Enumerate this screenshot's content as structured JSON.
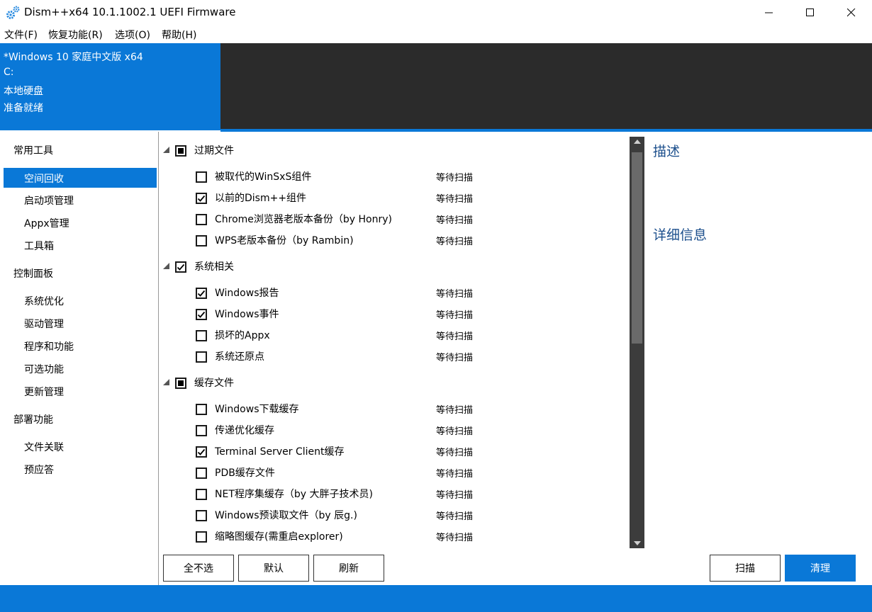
{
  "window": {
    "title": "Dism++x64 10.1.1002.1 UEFI Firmware",
    "minimize_icon": "minimize-icon",
    "maximize_icon": "maximize-icon",
    "close_icon": "close-icon"
  },
  "menu": [
    "文件(F)",
    "恢复功能(R)",
    "选项(O)",
    "帮助(H)"
  ],
  "system": {
    "os": "*Windows 10 家庭中文版 x64",
    "drive": "C:",
    "disk_type": "本地硬盘",
    "status": "准备就绪"
  },
  "sidebar": {
    "groups": [
      {
        "label": "常用工具",
        "items": [
          "空间回收",
          "启动项管理",
          "Appx管理",
          "工具箱"
        ]
      },
      {
        "label": "控制面板",
        "items": [
          "系统优化",
          "驱动管理",
          "程序和功能",
          "可选功能",
          "更新管理"
        ]
      },
      {
        "label": "部署功能",
        "items": [
          "文件关联",
          "预应答"
        ]
      }
    ],
    "selected": "空间回收"
  },
  "cleanup": {
    "status_text": "等待扫描",
    "groups": [
      {
        "label": "过期文件",
        "state": "indeterminate",
        "items": [
          {
            "label": "被取代的WinSxS组件",
            "checked": false
          },
          {
            "label": "以前的Dism++组件",
            "checked": true
          },
          {
            "label": "Chrome浏览器老版本备份（by Honry)",
            "checked": false
          },
          {
            "label": "WPS老版本备份（by Rambin)",
            "checked": false
          }
        ]
      },
      {
        "label": "系统相关",
        "state": "checked",
        "items": [
          {
            "label": "Windows报告",
            "checked": true
          },
          {
            "label": "Windows事件",
            "checked": true
          },
          {
            "label": "损坏的Appx",
            "checked": false
          },
          {
            "label": "系统还原点",
            "checked": false
          }
        ]
      },
      {
        "label": "缓存文件",
        "state": "indeterminate",
        "items": [
          {
            "label": "Windows下载缓存",
            "checked": false
          },
          {
            "label": "传递优化缓存",
            "checked": false
          },
          {
            "label": "Terminal Server Client缓存",
            "checked": true
          },
          {
            "label": "PDB缓存文件",
            "checked": false
          },
          {
            "label": "NET程序集缓存（by 大胖子技术员)",
            "checked": false
          },
          {
            "label": "Windows预读取文件（by 辰g.)",
            "checked": false
          },
          {
            "label": "缩略图缓存(需重启explorer)",
            "checked": false
          }
        ]
      }
    ]
  },
  "panel": {
    "description_title": "描述",
    "details_title": "详细信息"
  },
  "buttons": {
    "deselect_all": "全不选",
    "default": "默认",
    "refresh": "刷新",
    "scan": "扫描",
    "clean": "清理"
  },
  "colors": {
    "accent": "#0a78d7",
    "header_dark": "#2b2b2b",
    "panel_title": "#1c4f8c"
  }
}
